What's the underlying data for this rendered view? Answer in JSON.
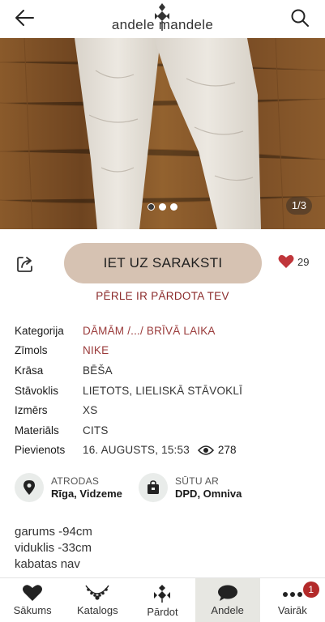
{
  "header": {
    "logo_text": "andele mandele",
    "back_icon": "arrow-left-icon",
    "search_icon": "search-icon"
  },
  "gallery": {
    "counter": "1/3",
    "total_images": 3,
    "active_index": 0
  },
  "actions": {
    "cta_label": "IET UZ SARAKSTI",
    "likes": "29",
    "sold_note": "PĒRLE IR PĀRDOTA TEV"
  },
  "details": {
    "rows": [
      {
        "key": "Kategorija",
        "value": "DĀMĀM /.../ BRĪVĀ LAIKA"
      },
      {
        "key": "Zīmols",
        "value": "NIKE"
      },
      {
        "key": "Krāsa",
        "value": "BĒŠA"
      },
      {
        "key": "Stāvoklis",
        "value": "LIETOTS, LIELISKĀ STĀVOKLĪ"
      },
      {
        "key": "Izmērs",
        "value": "XS"
      },
      {
        "key": "Materiāls",
        "value": "CITS"
      },
      {
        "key": "Pievienots",
        "value": "16. AUGUSTS, 15:53"
      }
    ],
    "views": "278"
  },
  "location": {
    "label": "ATRODAS",
    "value": "Rīga, Vidzeme"
  },
  "shipping": {
    "label": "SŪTU AR",
    "value": "DPD, Omniva"
  },
  "description": {
    "lines": [
      "garums -94cm",
      "viduklis -33cm",
      "kabatas nav"
    ]
  },
  "tabbar": {
    "tabs": [
      {
        "label": "Sākums",
        "icon": "heart-icon"
      },
      {
        "label": "Katalogs",
        "icon": "necklace-icon"
      },
      {
        "label": "Pārdot",
        "icon": "logo-mark-icon"
      },
      {
        "label": "Andele",
        "icon": "chat-bubble-icon"
      },
      {
        "label": "Vairāk",
        "icon": "more-dots-icon"
      }
    ],
    "active": "Andele",
    "badge": "1"
  },
  "colors": {
    "accent_link": "#9a3a3a",
    "cta_bg": "#d6c2b2",
    "heart": "#c0363b",
    "badge": "#b32a2a"
  }
}
